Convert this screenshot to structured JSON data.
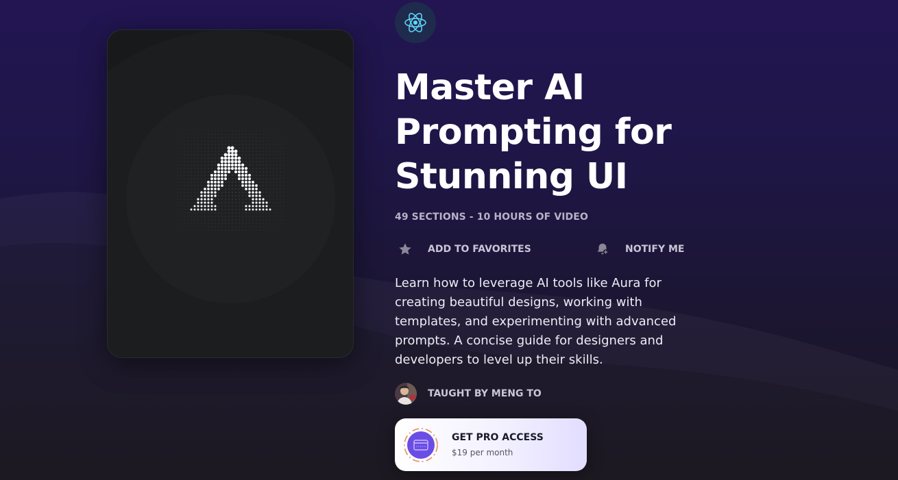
{
  "course": {
    "tech_icon": "react-icon",
    "cover_icon": "aura-logo-icon",
    "title": "Master AI Prompting for Stunning UI",
    "meta": "49 SECTIONS - 10 HOURS OF VIDEO",
    "description": "Learn how to leverage AI tools like Aura for creating beautiful designs, working with templates, and experimenting with advanced prompts. A concise guide for designers and developers to level up their skills."
  },
  "actions": {
    "favorites_label": "ADD TO FAVORITES",
    "favorites_icon": "star-icon",
    "notify_label": "NOTIFY ME",
    "notify_icon": "bell-plus-icon"
  },
  "teacher": {
    "label": "TAUGHT BY MENG TO",
    "avatar_icon": "avatar"
  },
  "pro": {
    "title": "GET PRO ACCESS",
    "price": "$19 per month",
    "icon": "pro-card-icon"
  },
  "colors": {
    "accent": "#6b4de6",
    "react": "#61dafb",
    "background_top": "#221552",
    "background_bottom": "#19151f"
  }
}
